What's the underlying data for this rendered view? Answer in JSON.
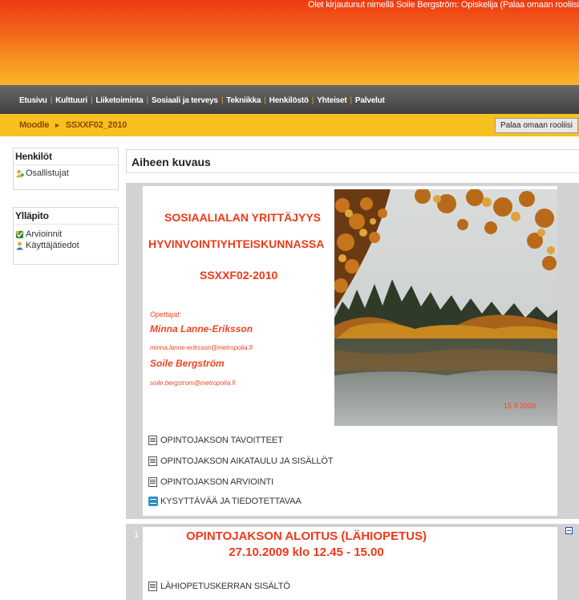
{
  "header": {
    "login_text": "Olet kirjautunut nimellä Soile Bergström: Opiskelija (Palaa omaan rooliisi"
  },
  "nav": {
    "items": [
      "Etusivu",
      "Kulttuuri",
      "Liiketoiminta",
      "Sosiaali ja terveys",
      "Tekniikka",
      "Henkilöstö",
      "Yhteiset",
      "Palvelut"
    ]
  },
  "breadcrumb": {
    "home": "Moodle",
    "arrow": "►",
    "course": "SSXXF02_2010",
    "return_button": "Palaa omaan rooliisi"
  },
  "blocks": {
    "people": {
      "title": "Henkilöt",
      "items": [
        "Osallistujat"
      ]
    },
    "admin": {
      "title": "Ylläpito",
      "items": [
        "Arvioinnit",
        "Käyttäjätiedot"
      ]
    }
  },
  "main": {
    "topic_title": "Aiheen kuvaus",
    "summary": {
      "title_line1": "SOSIAALIALAN YRITTÄJYYS",
      "title_line2": "HYVINVOINTIYHTEISKUNNASSA",
      "code": "SSXXF02-2010",
      "teachers_label": "Opettajat:",
      "teacher1_name": "Minna Lanne-Eriksson",
      "teacher1_email": "minna.lanne-eriksson@metropolia.fi",
      "teacher2_name": "Soile Bergström",
      "teacher2_email": "soile.bergstrom@metropolia.fi",
      "photo_date": "15 9 2009"
    },
    "resources": [
      "OPINTOJAKSON TAVOITTEET",
      "OPINTOJAKSON AIKATAULU JA SISÄLLÖT",
      "OPINTOJAKSON ARVIOINTI",
      "KYSYTTÄVÄÄ JA TIEDOTETTAVAA"
    ],
    "section1": {
      "number": "1",
      "title_line1": "OPINTOJAKSON ALOITUS (LÄHIOPETUS)",
      "title_line2": "27.10.2009 klo 12.45 - 15.00",
      "resources": [
        "LÄHIOPETUSKERRAN SISÄLTÖ"
      ]
    }
  },
  "colors": {
    "accent_red": "#f03818",
    "nav_separator": "#e49a2a",
    "breadcrumb_bg": "#f6c01f"
  }
}
